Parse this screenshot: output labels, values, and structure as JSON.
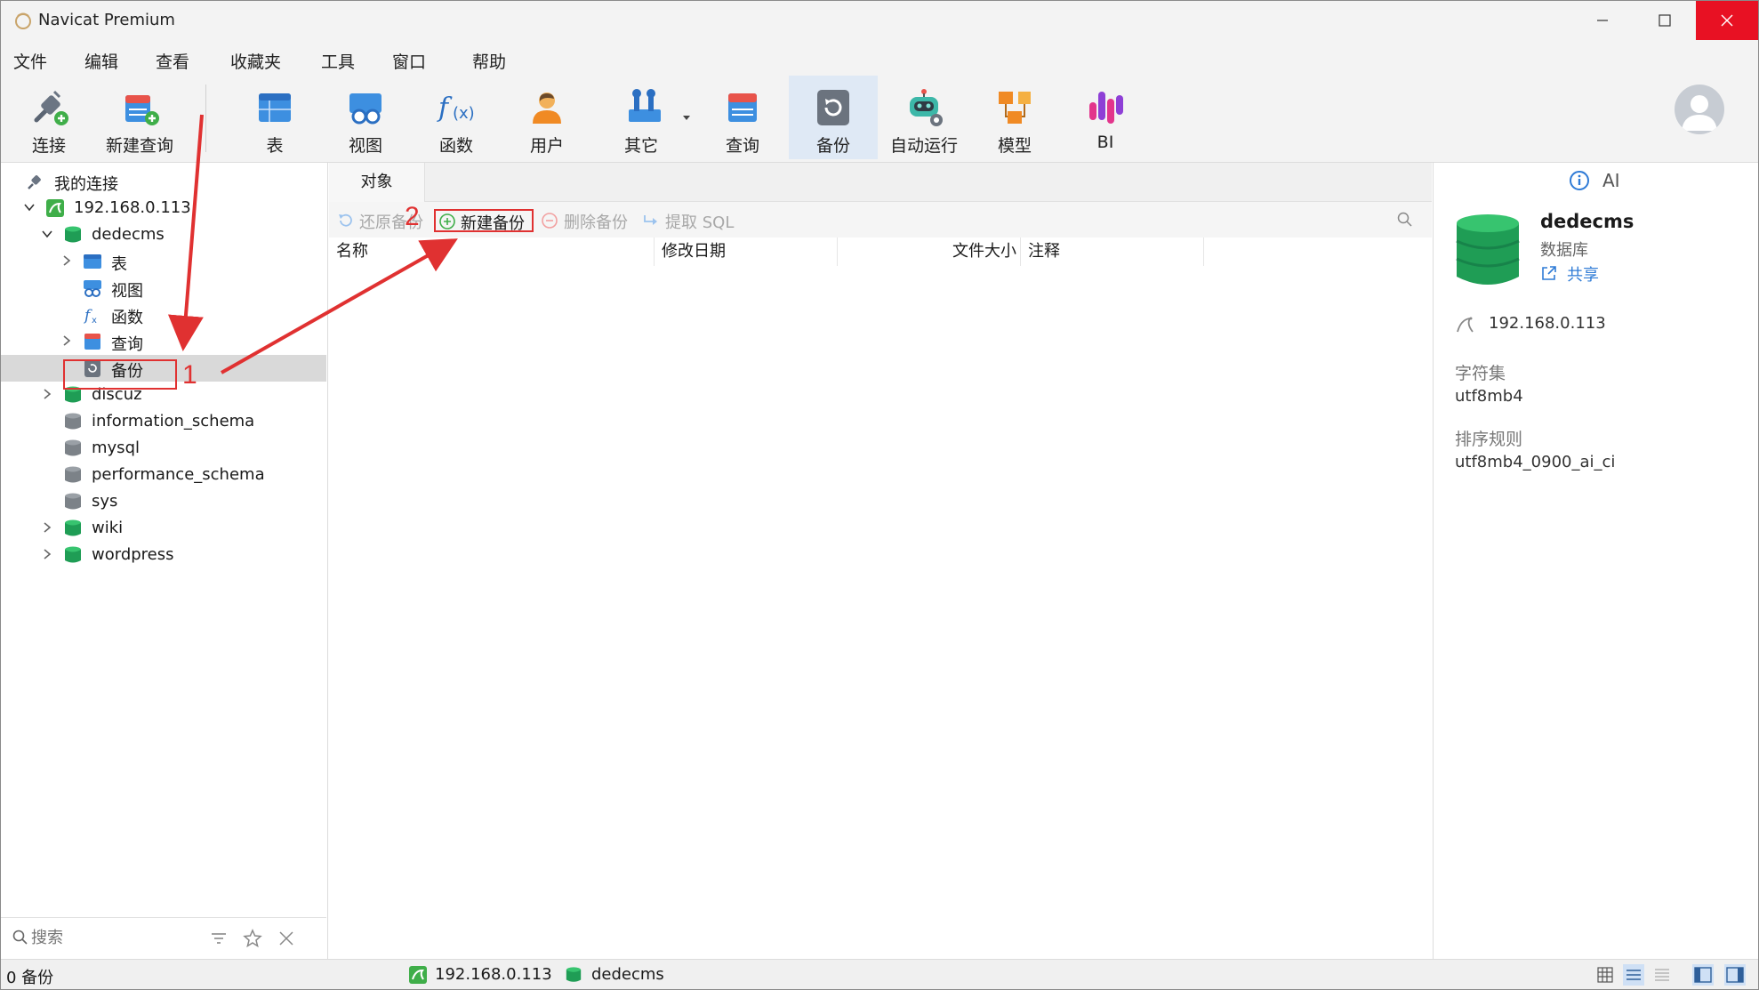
{
  "window": {
    "title": "Navicat Premium"
  },
  "menu": [
    "文件",
    "编辑",
    "查看",
    "收藏夹",
    "工具",
    "窗口",
    "帮助"
  ],
  "toolbar": {
    "connect": "连接",
    "new_query": "新建查询",
    "table": "表",
    "view": "视图",
    "function": "函数",
    "user": "用户",
    "other": "其它",
    "query": "查询",
    "backup": "备份",
    "automation": "自动运行",
    "model": "模型",
    "bi": "BI"
  },
  "tree": {
    "root": "我的连接",
    "connection": "192.168.0.113",
    "db_open": "dedecms",
    "children": [
      "表",
      "视图",
      "函数",
      "查询",
      "备份"
    ],
    "databases": [
      "discuz",
      "information_schema",
      "mysql",
      "performance_schema",
      "sys",
      "wiki",
      "wordpress"
    ]
  },
  "left_search": {
    "placeholder": "搜索"
  },
  "center": {
    "tab": "对象",
    "actions": {
      "restore": "还原备份",
      "new": "新建备份",
      "delete": "删除备份",
      "extract": "提取 SQL"
    },
    "columns": [
      "名称",
      "修改日期",
      "文件大小",
      "注释"
    ]
  },
  "info": {
    "ai": "AI",
    "name": "dedecms",
    "type": "数据库",
    "share": "共享",
    "host": "192.168.0.113",
    "charset_label": "字符集",
    "charset": "utf8mb4",
    "collation_label": "排序规则",
    "collation": "utf8mb4_0900_ai_ci"
  },
  "status": {
    "count": "0 备份",
    "connection": "192.168.0.113",
    "database": "dedecms"
  },
  "annotations": {
    "step1": "1",
    "step2": "2"
  },
  "colors": {
    "accent": "#2f7bd6",
    "selection": "#d9d9d9",
    "annotation": "#e03131",
    "db_green": "#1f9d55"
  }
}
